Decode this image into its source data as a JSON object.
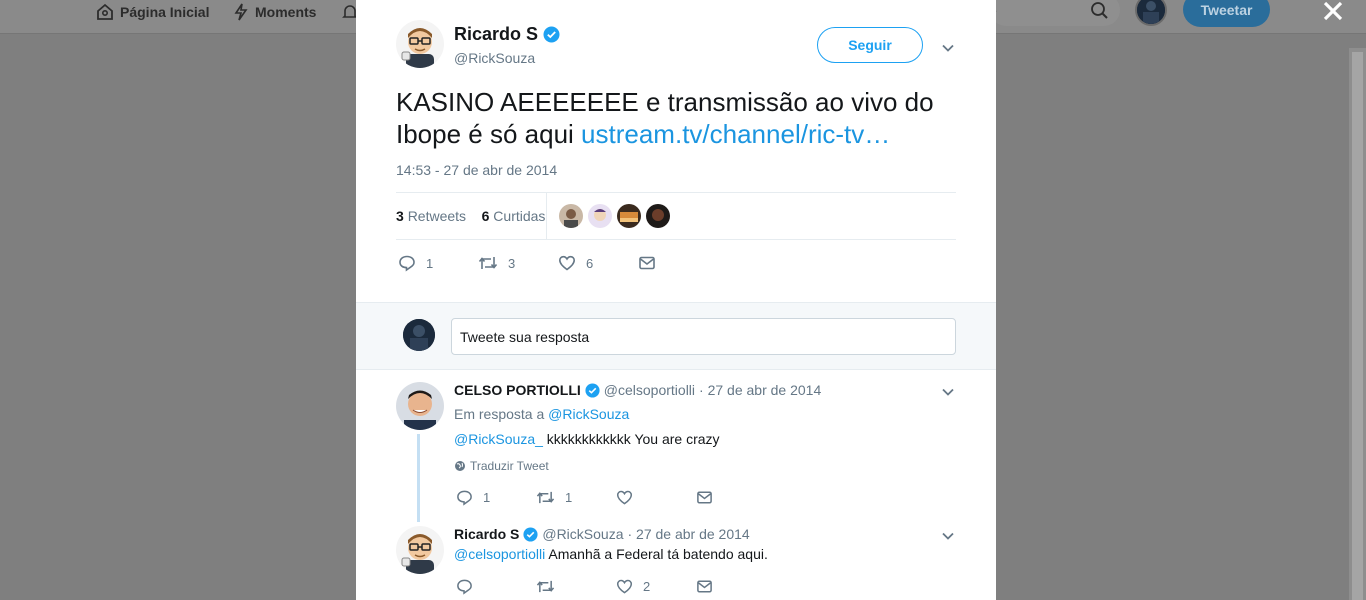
{
  "nav": {
    "home_label": "Página Inicial",
    "moments_label": "Moments",
    "search_partial": "e",
    "tweet_button": "Tweetar"
  },
  "tweet": {
    "author_name": "Ricardo S",
    "author_handle": "@RickSouza",
    "follow_label": "Seguir",
    "text": "KASINO AEEEEEEE e transmissão ao vivo do Ibope é só aqui ",
    "link": "ustream.tv/channel/ric-tv…",
    "timestamp": "14:53 - 27 de abr de 2014",
    "retweets_count": "3",
    "retweets_label": "Retweets",
    "likes_count": "6",
    "likes_label": "Curtidas",
    "reply_count": "1",
    "retweet_action_count": "3",
    "like_action_count": "6"
  },
  "reply_box": {
    "placeholder": "Tweete sua resposta"
  },
  "replies": [
    {
      "author_name": "CELSO PORTIOLLI",
      "author_handle": "@celsoportiolli",
      "date": "· 27 de abr de 2014",
      "in_reply_prefix": "Em resposta a ",
      "in_reply_handle": "@RickSouza",
      "mention": "@RickSouza_",
      "text": " kkkkkkkkkkkk You are crazy",
      "translate_label": "Traduzir Tweet",
      "reply_count": "1",
      "retweet_count": "1"
    },
    {
      "author_name": "Ricardo S",
      "author_handle": "@RickSouza",
      "date": "· 27 de abr de 2014",
      "mention": "@celsoportiolli",
      "text": " Amanhã a Federal tá batendo aqui.",
      "like_count": "2"
    }
  ],
  "colors": {
    "accent": "#1da1f2",
    "link": "#1b95e0",
    "muted": "#657786",
    "overlay": "#7f7f7f"
  }
}
